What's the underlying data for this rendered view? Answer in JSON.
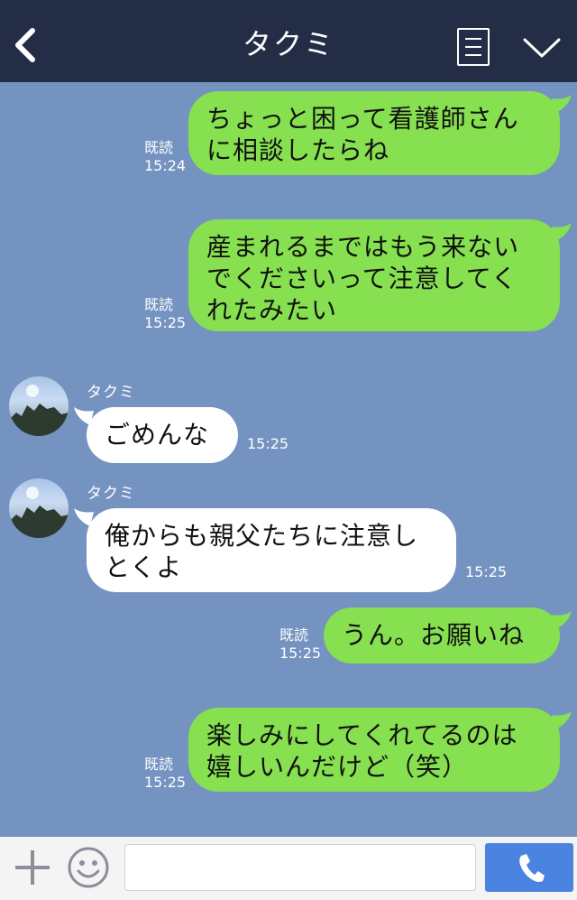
{
  "header": {
    "title": "タクミ"
  },
  "messages": [
    {
      "type": "out",
      "text": "ちょっと困って看護師さん\nに相談したらね",
      "read": "既読",
      "time": "15:24"
    },
    {
      "type": "out",
      "text": "産まれるまではもう来ない\nでくださいって注意してく\nれたみたい",
      "read": "既読",
      "time": "15:25"
    },
    {
      "type": "in",
      "sender": "タクミ",
      "text": "ごめんな",
      "time": "15:25"
    },
    {
      "type": "in",
      "sender": "タクミ",
      "text": "俺からも親父たちに注意し\nとくよ",
      "time": "15:25"
    },
    {
      "type": "out",
      "text": "うん。お願いね",
      "read": "既読",
      "time": "15:25"
    },
    {
      "type": "out",
      "text": "楽しみにしてくれてるのは\n嬉しいんだけど（笑）",
      "read": "既読",
      "time": "15:25"
    }
  ],
  "input": {
    "placeholder": "",
    "value": ""
  },
  "icons": {
    "back": "back-icon",
    "menu": "menu-icon",
    "chevron": "chevron-down-icon",
    "plus": "plus-icon",
    "emoji": "emoji-icon",
    "call": "phone-icon",
    "avatar": "avatar-image"
  },
  "colors": {
    "header_bg": "#232d45",
    "chat_bg": "#7493c0",
    "out_bubble": "#86e050",
    "in_bubble": "#ffffff",
    "call_button": "#4b84e0"
  }
}
